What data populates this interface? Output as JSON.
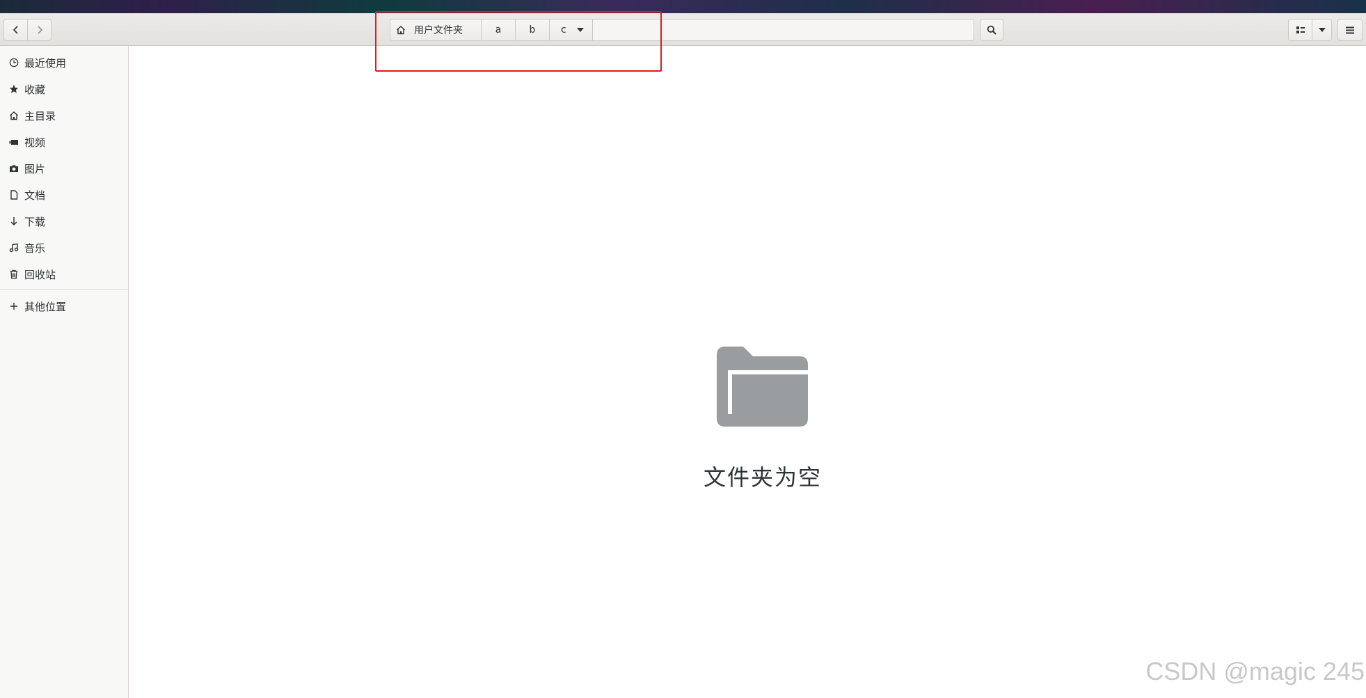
{
  "window": {
    "back_icon": "chevron-left-icon",
    "forward_icon": "chevron-right-icon"
  },
  "path_bar": {
    "home_label": "用户文件夹",
    "crumbs": [
      "a",
      "b",
      "c"
    ]
  },
  "sidebar": {
    "items": [
      {
        "icon": "clock-icon",
        "label": "最近使用"
      },
      {
        "icon": "star-icon",
        "label": "收藏"
      },
      {
        "icon": "home-icon",
        "label": "主目录"
      },
      {
        "icon": "video-icon",
        "label": "视频"
      },
      {
        "icon": "camera-icon",
        "label": "图片"
      },
      {
        "icon": "document-icon",
        "label": "文档"
      },
      {
        "icon": "download-icon",
        "label": "下载"
      },
      {
        "icon": "music-icon",
        "label": "音乐"
      },
      {
        "icon": "trash-icon",
        "label": "回收站"
      }
    ],
    "other": {
      "icon": "plus-icon",
      "label": "其他位置"
    }
  },
  "main": {
    "empty_label": "文件夹为空"
  },
  "watermark": "CSDN @magic 245",
  "colors": {
    "highlight": "#e0191e",
    "folder_icon": "#9a9d9f",
    "sidebar_bg": "#f8f8f7"
  }
}
